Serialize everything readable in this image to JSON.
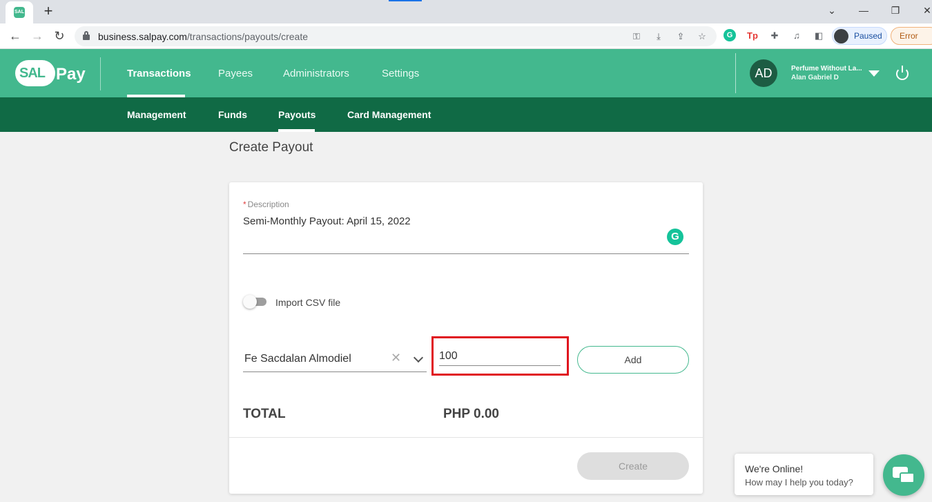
{
  "browser": {
    "tab_favicon_text": "SAL",
    "new_tab": "+",
    "window_controls": [
      "⌄",
      "—",
      "❐",
      "✕"
    ],
    "nav": {
      "back": "←",
      "forward": "→",
      "reload": "↻"
    },
    "url_host": "business.salpay.com",
    "url_path": "/transactions/payouts/create",
    "profile_label": "Paused",
    "error_label": "Error",
    "icons": [
      "key-icon",
      "download-icon",
      "share-icon",
      "star-icon",
      "grammarly-ext-icon",
      "tp-ext-icon",
      "puzzle-icon",
      "media-icon",
      "sidebar-icon"
    ]
  },
  "app": {
    "brand_colors": {
      "primary": "#43b88e",
      "dark": "#106a45"
    },
    "logo": {
      "sal": "SAL",
      "pay": "Pay"
    },
    "top_nav": [
      {
        "label": "Transactions",
        "active": true
      },
      {
        "label": "Payees",
        "active": false
      },
      {
        "label": "Administrators",
        "active": false
      },
      {
        "label": "Settings",
        "active": false
      }
    ],
    "sub_nav": [
      {
        "label": "Management",
        "active": false
      },
      {
        "label": "Funds",
        "active": false
      },
      {
        "label": "Payouts",
        "active": true
      },
      {
        "label": "Card Management",
        "active": false
      }
    ],
    "user": {
      "initials": "AD",
      "org": "Perfume Without La...",
      "name": "Alan Gabriel D"
    }
  },
  "page": {
    "title": "Create Payout",
    "description": {
      "required_mark": "*",
      "label": "Description",
      "value": "Semi-Monthly Payout: April 15, 2022"
    },
    "import_csv": {
      "label": "Import CSV file",
      "on": false
    },
    "payee": {
      "selected": "Fe Sacdalan Almodiel",
      "clear": "✕"
    },
    "amount": {
      "value": "100"
    },
    "add_label": "Add",
    "total_label": "TOTAL",
    "total_value": "PHP 0.00",
    "create_label": "Create"
  },
  "chat": {
    "title": "We're Online!",
    "subtitle": "How may I help you today?"
  }
}
